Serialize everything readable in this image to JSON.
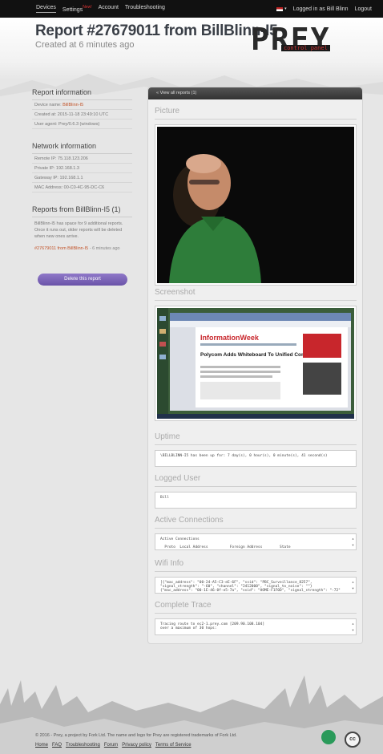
{
  "topbar": {
    "nav": [
      {
        "label": "Devices"
      },
      {
        "label": "Settings",
        "badge": "New!"
      },
      {
        "label": "Account"
      },
      {
        "label": "Troubleshooting"
      }
    ],
    "logged_in": "Logged in as Bill Blinn",
    "logout": "Logout"
  },
  "header": {
    "title": "Report #27679011 from BillBlinn-I5",
    "subtitle": "Created at 6 minutes ago",
    "logo_word": "PREY",
    "logo_tag": "control panel"
  },
  "sidebar": {
    "report_info": {
      "title": "Report information",
      "device_name_label": "Device name:",
      "device_name_value": "BillBlinn-I5",
      "created_at": "Created at: 2015-11-18 23:49:10 UTC",
      "user_agent": "User agent: Prey/0.6.3 (windows)"
    },
    "network_info": {
      "title": "Network information",
      "rows": [
        "Remote IP: 75.118.123.206",
        "Private IP: 192.168.1.3",
        "Gateway IP: 192.168.1.1",
        "MAC Address: 00-C0-4C-95-DC-C6"
      ]
    },
    "reports": {
      "title": "Reports from BillBlinn-I5 (1)",
      "text": "BillBlinn-I5 has space for 9 additional reports. Once it runs out, older reports will be deleted when new ones arrive.",
      "link": "#27679011 from BillBlinn-I5",
      "link_time": "- 6 minutes ago"
    },
    "delete_button": "Delete this report"
  },
  "main": {
    "view_all": "« View all reports (1)",
    "picture_title": "Picture",
    "screenshot_title": "Screenshot",
    "screenshot_content": {
      "headline": "InformationWeek",
      "article": "Polycom Adds Whiteboard To Unified Communications"
    },
    "uptime_title": "Uptime",
    "uptime_value": "\\BILLBLINN-I5 has been up for: 7 day(s), 0 hour(s), 0 minute(s), 41 second(s)",
    "logged_user_title": "Logged User",
    "logged_user_value": "Bill",
    "active_connections_title": "Active Connections",
    "active_connections_value": "Active Connections\n\n  Proto  Local Address          Foreign Address        State",
    "wifi_info_title": "Wifi Info",
    "wifi_info_value": "[{\"mac_address\": \"00-24-A5-C3-eE-6F\", \"ssid\": \"PBC_Surveillance_8257\",\n\"signal_strength\": \"-60\", \"channel\": \"2412000\", \"signal_to_noise\": \"\"}\n{\"mac_address\": \"00-1E-46-0f-e5-7a\", \"ssid\": \"HOME-F1F0D\", \"signal_strength\": \"-72\"",
    "complete_trace_title": "Complete Trace",
    "complete_trace_value": "Tracing route to ec2-1.prey.com [209.90.108.104]\nover a maximum of 30 hops:"
  },
  "footer": {
    "copyright": "© 2016 - Prey, a project by Fork Ltd. The name and logo for Prey are registered trademarks of Fork Ltd.",
    "links": [
      "Home",
      "FAQ",
      "Troubleshooting",
      "Forum",
      "Privacy policy",
      "Terms of Service"
    ],
    "cc_label": "cc"
  },
  "colors": {
    "accent": "#c2542a",
    "button": "#7660b8",
    "topbar": "#111111"
  }
}
